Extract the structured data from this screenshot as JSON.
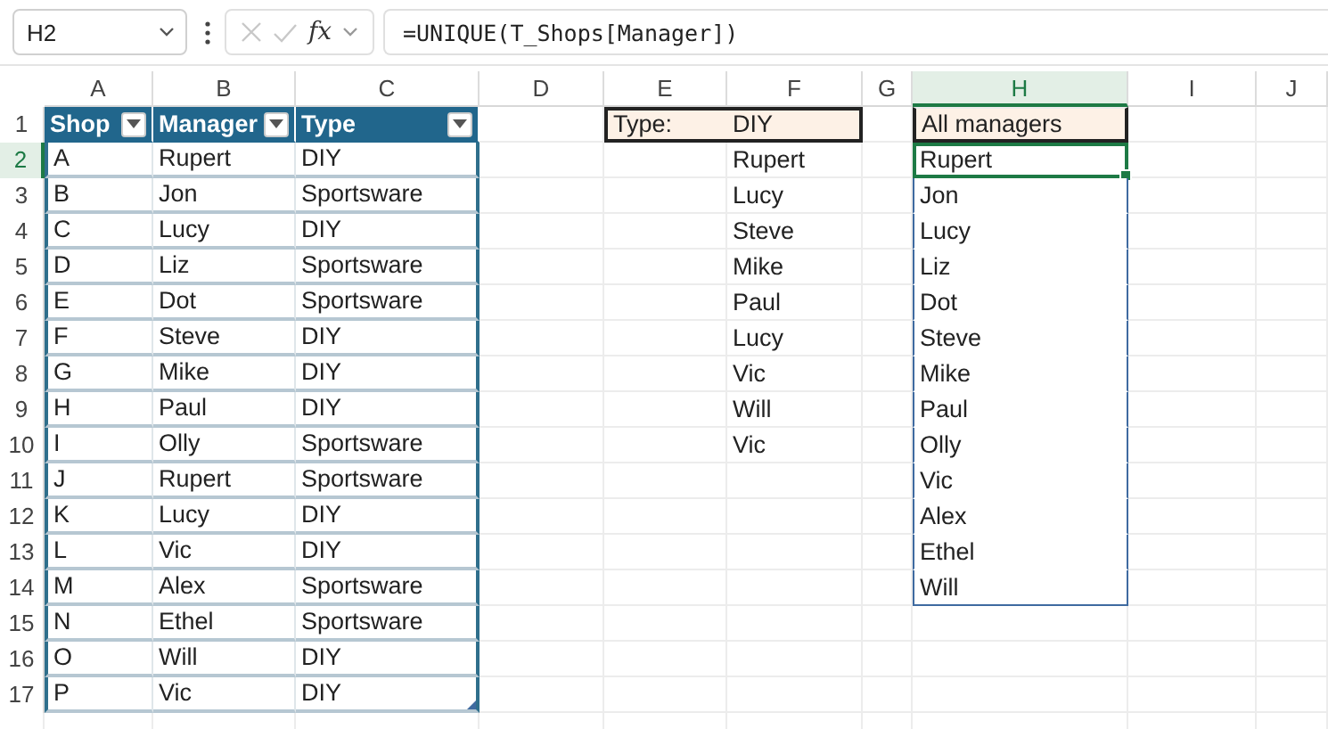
{
  "formula_bar": {
    "name_box": "H2",
    "function_label": "fx",
    "formula": "=UNIQUE(T_Shops[Manager])"
  },
  "columns": [
    {
      "label": "A",
      "selected": false
    },
    {
      "label": "B",
      "selected": false
    },
    {
      "label": "C",
      "selected": false
    },
    {
      "label": "D",
      "selected": false
    },
    {
      "label": "E",
      "selected": false
    },
    {
      "label": "F",
      "selected": false
    },
    {
      "label": "G",
      "selected": false
    },
    {
      "label": "H",
      "selected": true
    },
    {
      "label": "I",
      "selected": false
    },
    {
      "label": "J",
      "selected": false
    }
  ],
  "rows": [
    {
      "label": "1",
      "selected": false
    },
    {
      "label": "2",
      "selected": true
    },
    {
      "label": "3",
      "selected": false
    },
    {
      "label": "4",
      "selected": false
    },
    {
      "label": "5",
      "selected": false
    },
    {
      "label": "6",
      "selected": false
    },
    {
      "label": "7",
      "selected": false
    },
    {
      "label": "8",
      "selected": false
    },
    {
      "label": "9",
      "selected": false
    },
    {
      "label": "10",
      "selected": false
    },
    {
      "label": "11",
      "selected": false
    },
    {
      "label": "12",
      "selected": false
    },
    {
      "label": "13",
      "selected": false
    },
    {
      "label": "14",
      "selected": false
    },
    {
      "label": "15",
      "selected": false
    },
    {
      "label": "16",
      "selected": false
    },
    {
      "label": "17",
      "selected": false
    }
  ],
  "table": {
    "columns": [
      "Shop",
      "Manager",
      "Type"
    ],
    "rows": [
      [
        "A",
        "Rupert",
        "DIY"
      ],
      [
        "B",
        "Jon",
        "Sportsware"
      ],
      [
        "C",
        "Lucy",
        "DIY"
      ],
      [
        "D",
        "Liz",
        "Sportsware"
      ],
      [
        "E",
        "Dot",
        "Sportsware"
      ],
      [
        "F",
        "Steve",
        "DIY"
      ],
      [
        "G",
        "Mike",
        "DIY"
      ],
      [
        "H",
        "Paul",
        "DIY"
      ],
      [
        "I",
        "Olly",
        "Sportsware"
      ],
      [
        "J",
        "Rupert",
        "Sportsware"
      ],
      [
        "K",
        "Lucy",
        "DIY"
      ],
      [
        "L",
        "Vic",
        "DIY"
      ],
      [
        "M",
        "Alex",
        "Sportsware"
      ],
      [
        "N",
        "Ethel",
        "Sportsware"
      ],
      [
        "O",
        "Will",
        "DIY"
      ],
      [
        "P",
        "Vic",
        "DIY"
      ]
    ]
  },
  "filter": {
    "label": "Type:",
    "value": "DIY"
  },
  "filtered_managers": [
    "Rupert",
    "Lucy",
    "Steve",
    "Mike",
    "Paul",
    "Lucy",
    "Vic",
    "Will",
    "Vic"
  ],
  "unique_managers": {
    "header": "All managers",
    "values": [
      "Rupert",
      "Jon",
      "Lucy",
      "Liz",
      "Dot",
      "Steve",
      "Mike",
      "Paul",
      "Olly",
      "Vic",
      "Alex",
      "Ethel",
      "Will"
    ]
  }
}
